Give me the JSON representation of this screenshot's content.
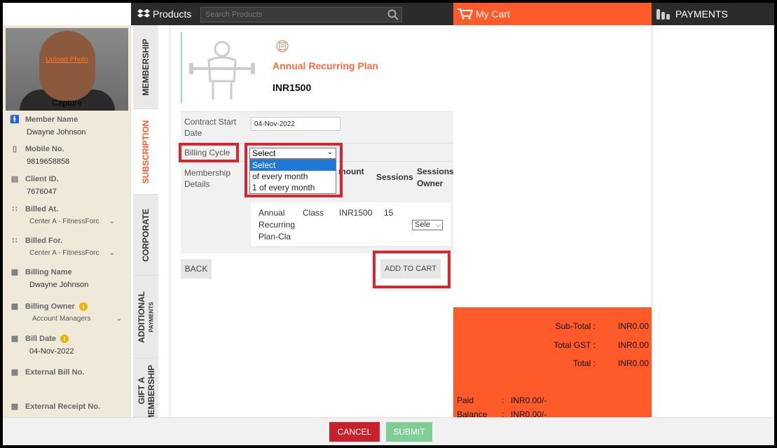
{
  "topbar": {
    "products_label": "Products",
    "search_placeholder": "Search Products",
    "cart_label": "My Cart",
    "payments_label": "PAYMENTS"
  },
  "member": {
    "upload_photo": "Upload Photo",
    "capture": "Capture",
    "member_name_label": "Member Name",
    "member_name": "Dwayne Johnson",
    "mobile_label": "Mobile No.",
    "mobile": "9819658858",
    "client_id_label": "Client ID.",
    "client_id": "7676047",
    "billed_at_label": "Billed At.",
    "billed_at": "Center A - FitnessForc",
    "billed_for_label": "Billed For.",
    "billed_for": "Center A - FitnessForc",
    "billing_name_label": "Billing Name",
    "billing_name": "Dwayne  Johnson",
    "billing_owner_label": "Billing Owner",
    "billing_owner": "Account Managers",
    "bill_date_label": "Bill Date",
    "bill_date": "04-Nov-2022",
    "external_bill_label": "External Bill No.",
    "external_receipt_label": "External Receipt No."
  },
  "tabs": {
    "membership": "MEMBERSHIP",
    "subscription": "SUBSCRIPTION",
    "corporate": "CORPORATE",
    "additional": "ADDITIONAL",
    "payments": "PAYMENTS",
    "gift_a": "GIFT A",
    "gift_membership": "MEMBERSHIP"
  },
  "product": {
    "plan_name": "Annual Recurring Plan",
    "price": "INR1500",
    "contract_start_label_1": "Contract Start",
    "contract_start_label_2": "Date",
    "contract_start_value": "04-Nov-2022",
    "billing_cycle_label": "Billing Cycle",
    "billing_cycle_selected": "Select",
    "billing_cycle_options": [
      "Select",
      "of every month",
      "1 of every month"
    ],
    "membership_details_label_1": "Membership",
    "membership_details_label_2": "Details",
    "col_amount": "mount",
    "col_sessions": "Sessions",
    "col_sessions_owner_1": "Sessions",
    "col_sessions_owner_2": "Owner",
    "row_name_1": "Annual",
    "row_name_2": "Recurring",
    "row_name_3": "Plan-Cla",
    "row_type": "Class",
    "row_amount": "INR1500",
    "row_sessions": "15",
    "row_owner": "Sele",
    "back_label": "BACK",
    "add_to_cart_label": "ADD TO CART"
  },
  "cart": {
    "subtotal_label": "Sub-Total  :",
    "subtotal": "INR0.00",
    "gst_label": "Total GST  :",
    "gst": "INR0.00",
    "total_label": "Total  :",
    "total": "INR0.00",
    "paid_label": "Paid",
    "paid": "INR0.00/-",
    "balance_label": "Balance",
    "balance": "INR0.00/-",
    "colon": ":"
  },
  "footer": {
    "cancel_label": "CANCEL",
    "submit_label": "SUBMIT"
  },
  "colors": {
    "accent": "#ff5b2a",
    "highlight": "#d9262e",
    "cancel": "#c8202d",
    "submit": "#7fcf95"
  }
}
